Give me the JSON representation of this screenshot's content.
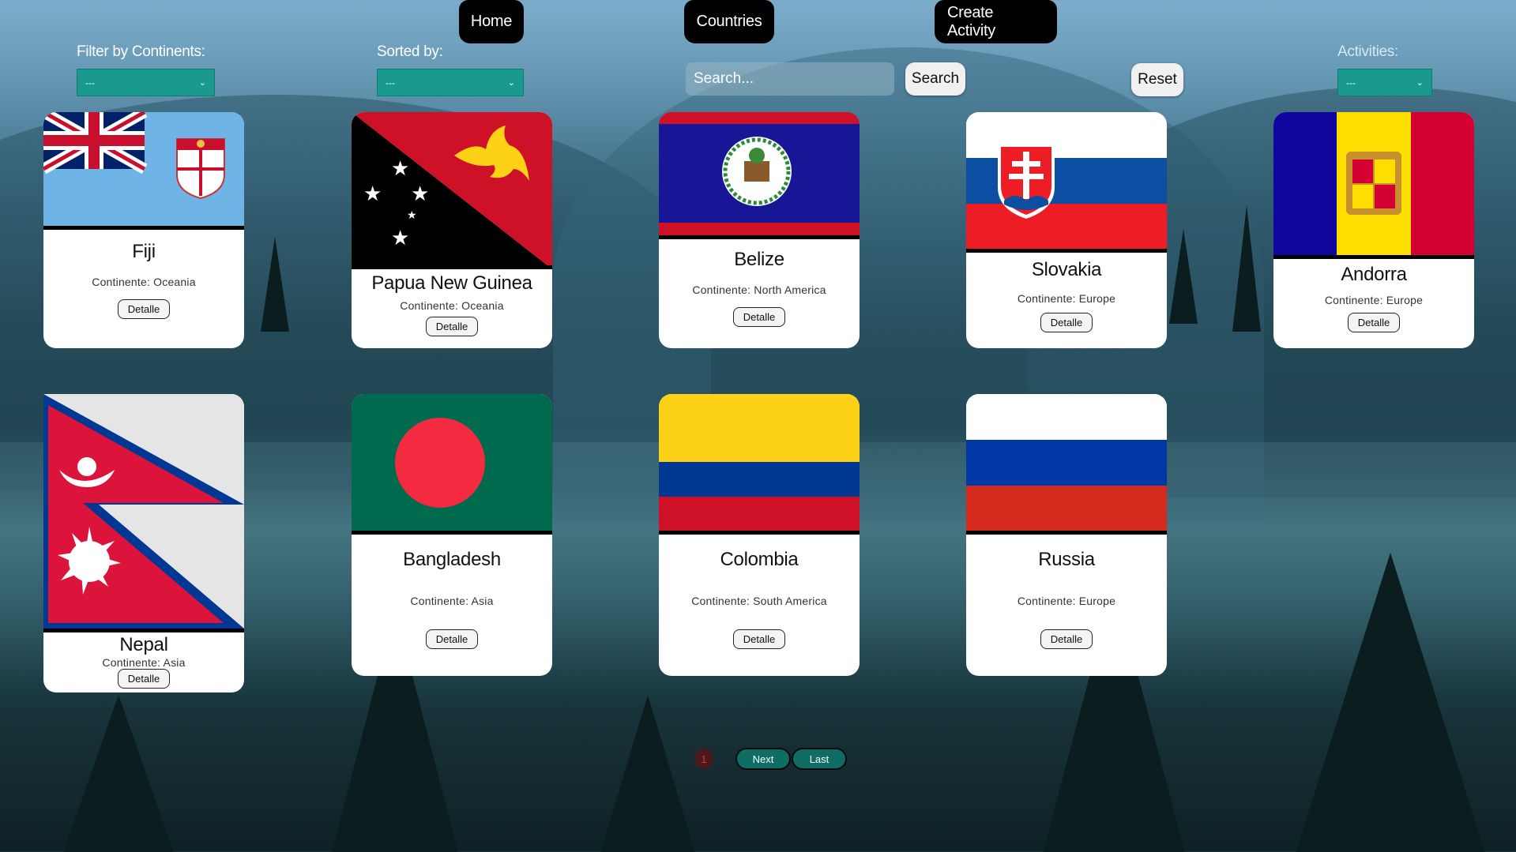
{
  "nav": {
    "home": "Home",
    "countries": "Countries",
    "create_activity": "Create Activity"
  },
  "filters": {
    "continent_label": "Filter by Continents:",
    "continent_value": "---",
    "sort_label": "Sorted by:",
    "sort_value": "---",
    "activities_label": "Activities:",
    "activities_value": "---"
  },
  "search": {
    "placeholder": "Search...",
    "button": "Search",
    "reset": "Reset"
  },
  "cards": [
    {
      "name": "Fiji",
      "continent": "Continente: Oceania",
      "detail": "Detalle"
    },
    {
      "name": "Papua New Guinea",
      "continent": "Continente: Oceania",
      "detail": "Detalle"
    },
    {
      "name": "Belize",
      "continent": "Continente: North America",
      "detail": "Detalle"
    },
    {
      "name": "Slovakia",
      "continent": "Continente: Europe",
      "detail": "Detalle"
    },
    {
      "name": "Andorra",
      "continent": "Continente: Europe",
      "detail": "Detalle"
    },
    {
      "name": "Nepal",
      "continent": "Continente: Asia",
      "detail": "Detalle"
    },
    {
      "name": "Bangladesh",
      "continent": "Continente: Asia",
      "detail": "Detalle"
    },
    {
      "name": "Colombia",
      "continent": "Continente: South America",
      "detail": "Detalle"
    },
    {
      "name": "Russia",
      "continent": "Continente: Europe",
      "detail": "Detalle"
    }
  ],
  "pagination": {
    "current": "1",
    "next": "Next",
    "last": "Last"
  },
  "colors": {
    "nav_bg": "#000000",
    "select_bg": "#1a9a8e",
    "pager_bg": "#0e6e66"
  }
}
